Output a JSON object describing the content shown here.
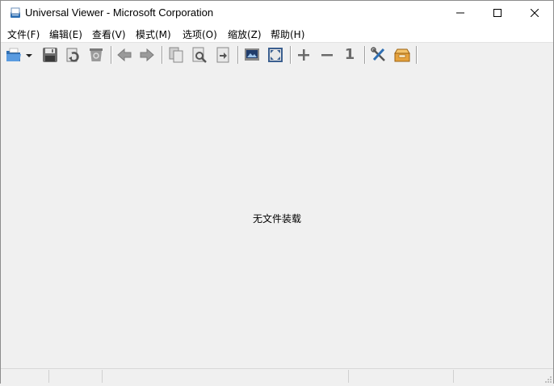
{
  "window": {
    "title": "Universal Viewer - Microsoft Corporation",
    "controls": {
      "minimize": "minimize",
      "maximize": "maximize",
      "close": "close"
    }
  },
  "menu": [
    {
      "label": "文件(F)"
    },
    {
      "label": "编辑(E)"
    },
    {
      "label": "查看(V)"
    },
    {
      "label": "模式(M)"
    },
    {
      "label": "选项(O)"
    },
    {
      "label": "缩放(Z)"
    },
    {
      "label": "帮助(H)"
    }
  ],
  "toolbar": {
    "buttons": [
      {
        "icon": "open-folder-icon"
      },
      {
        "icon": "dropdown-arrow-icon"
      },
      {
        "icon": "save-icon"
      },
      {
        "icon": "reload-icon"
      },
      {
        "icon": "delete-icon"
      },
      {
        "icon": "back-arrow-icon"
      },
      {
        "icon": "forward-arrow-icon"
      },
      {
        "icon": "copy-icon"
      },
      {
        "icon": "find-icon"
      },
      {
        "icon": "goto-icon"
      },
      {
        "icon": "image-view-icon"
      },
      {
        "icon": "fit-window-icon"
      },
      {
        "icon": "zoom-in-icon"
      },
      {
        "icon": "zoom-out-icon"
      },
      {
        "icon": "original-size-icon"
      },
      {
        "icon": "tools-icon"
      },
      {
        "icon": "plugin-box-icon"
      }
    ],
    "original_size_label": "1"
  },
  "content": {
    "empty_message": "无文件装载"
  },
  "colors": {
    "background": "#f0f0f0",
    "titlebar": "#ffffff",
    "icon_gray": "#7a7a7a",
    "folder_blue": "#3d7fc4"
  }
}
